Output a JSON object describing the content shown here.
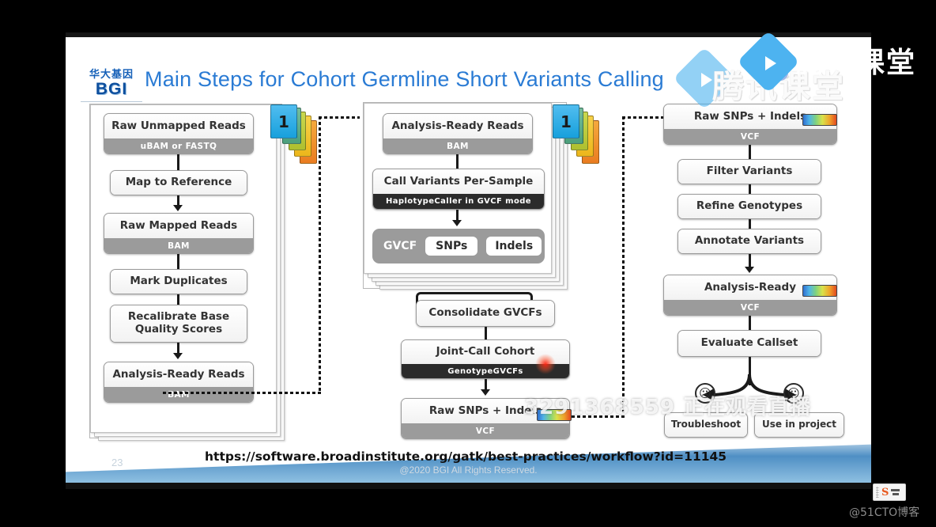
{
  "slide": {
    "title": "Main Steps for Cohort Germline Short Variants Calling",
    "logo": {
      "cn": "华大基因",
      "en": "BGI"
    },
    "footer": {
      "url": "https://software.broadinstitute.org/gatk/best-practices/workflow?id=11145",
      "copyright": "@2020 BGI All Rights Reserved.",
      "page_number": "23"
    }
  },
  "stage1": {
    "tab_label": "1",
    "nodes": [
      {
        "title": "Raw Unmapped Reads",
        "sub": "uBAM or FASTQ"
      },
      {
        "title": "Map to Reference",
        "sub": ""
      },
      {
        "title": "Raw Mapped Reads",
        "sub": "BAM"
      },
      {
        "title": "Mark Duplicates",
        "sub": ""
      },
      {
        "title": "Recalibrate Base\nQuality Scores",
        "sub": ""
      },
      {
        "title": "Analysis-Ready Reads",
        "sub": "BAM"
      }
    ]
  },
  "stage2": {
    "tab_label": "1",
    "nodes": [
      {
        "title": "Analysis-Ready Reads",
        "sub": "BAM"
      },
      {
        "title": "Call Variants Per-Sample",
        "sub": "HaplotypeCaller in GVCF mode"
      }
    ],
    "gvcf_row": {
      "label": "GVCF",
      "chips": [
        "SNPs",
        "Indels"
      ]
    },
    "consolidate": "Consolidate GVCFs",
    "joint_call": {
      "title": "Joint-Call Cohort",
      "sub": "GenotypeGVCFs"
    },
    "raw_output": {
      "title": "Raw SNPs + Indels",
      "sub": "VCF"
    }
  },
  "stage3": {
    "raw_input": {
      "title": "Raw SNPs + Indels",
      "sub": "VCF"
    },
    "steps": [
      "Filter Variants",
      "Refine Genotypes",
      "Annotate Variants"
    ],
    "analysis_ready": {
      "title": "Analysis-Ready",
      "sub": "VCF"
    },
    "evaluate": "Evaluate Callset",
    "outcomes": [
      {
        "face": "sad-face-icon",
        "label": "Troubleshoot"
      },
      {
        "face": "happy-face-icon",
        "label": "Use in project"
      }
    ]
  },
  "overlays": {
    "live_banner": "3291368559 正在观看直播",
    "brand_watermark": "腾讯课堂",
    "brand_logo_label": "腾讯课堂",
    "ime_label": "S",
    "blogger_tag": "@51CTO博客"
  },
  "colors": {
    "title_blue": "#2a7bd4",
    "tab_blue": "#35a8e0",
    "tab_green": "#5fb08a",
    "tab_lime": "#b7c93a",
    "tab_yellow": "#f0c31e",
    "tab_orange": "#f08a2a",
    "sub_gray": "#9b9b9b",
    "sub_dark": "#2b2b2b"
  }
}
